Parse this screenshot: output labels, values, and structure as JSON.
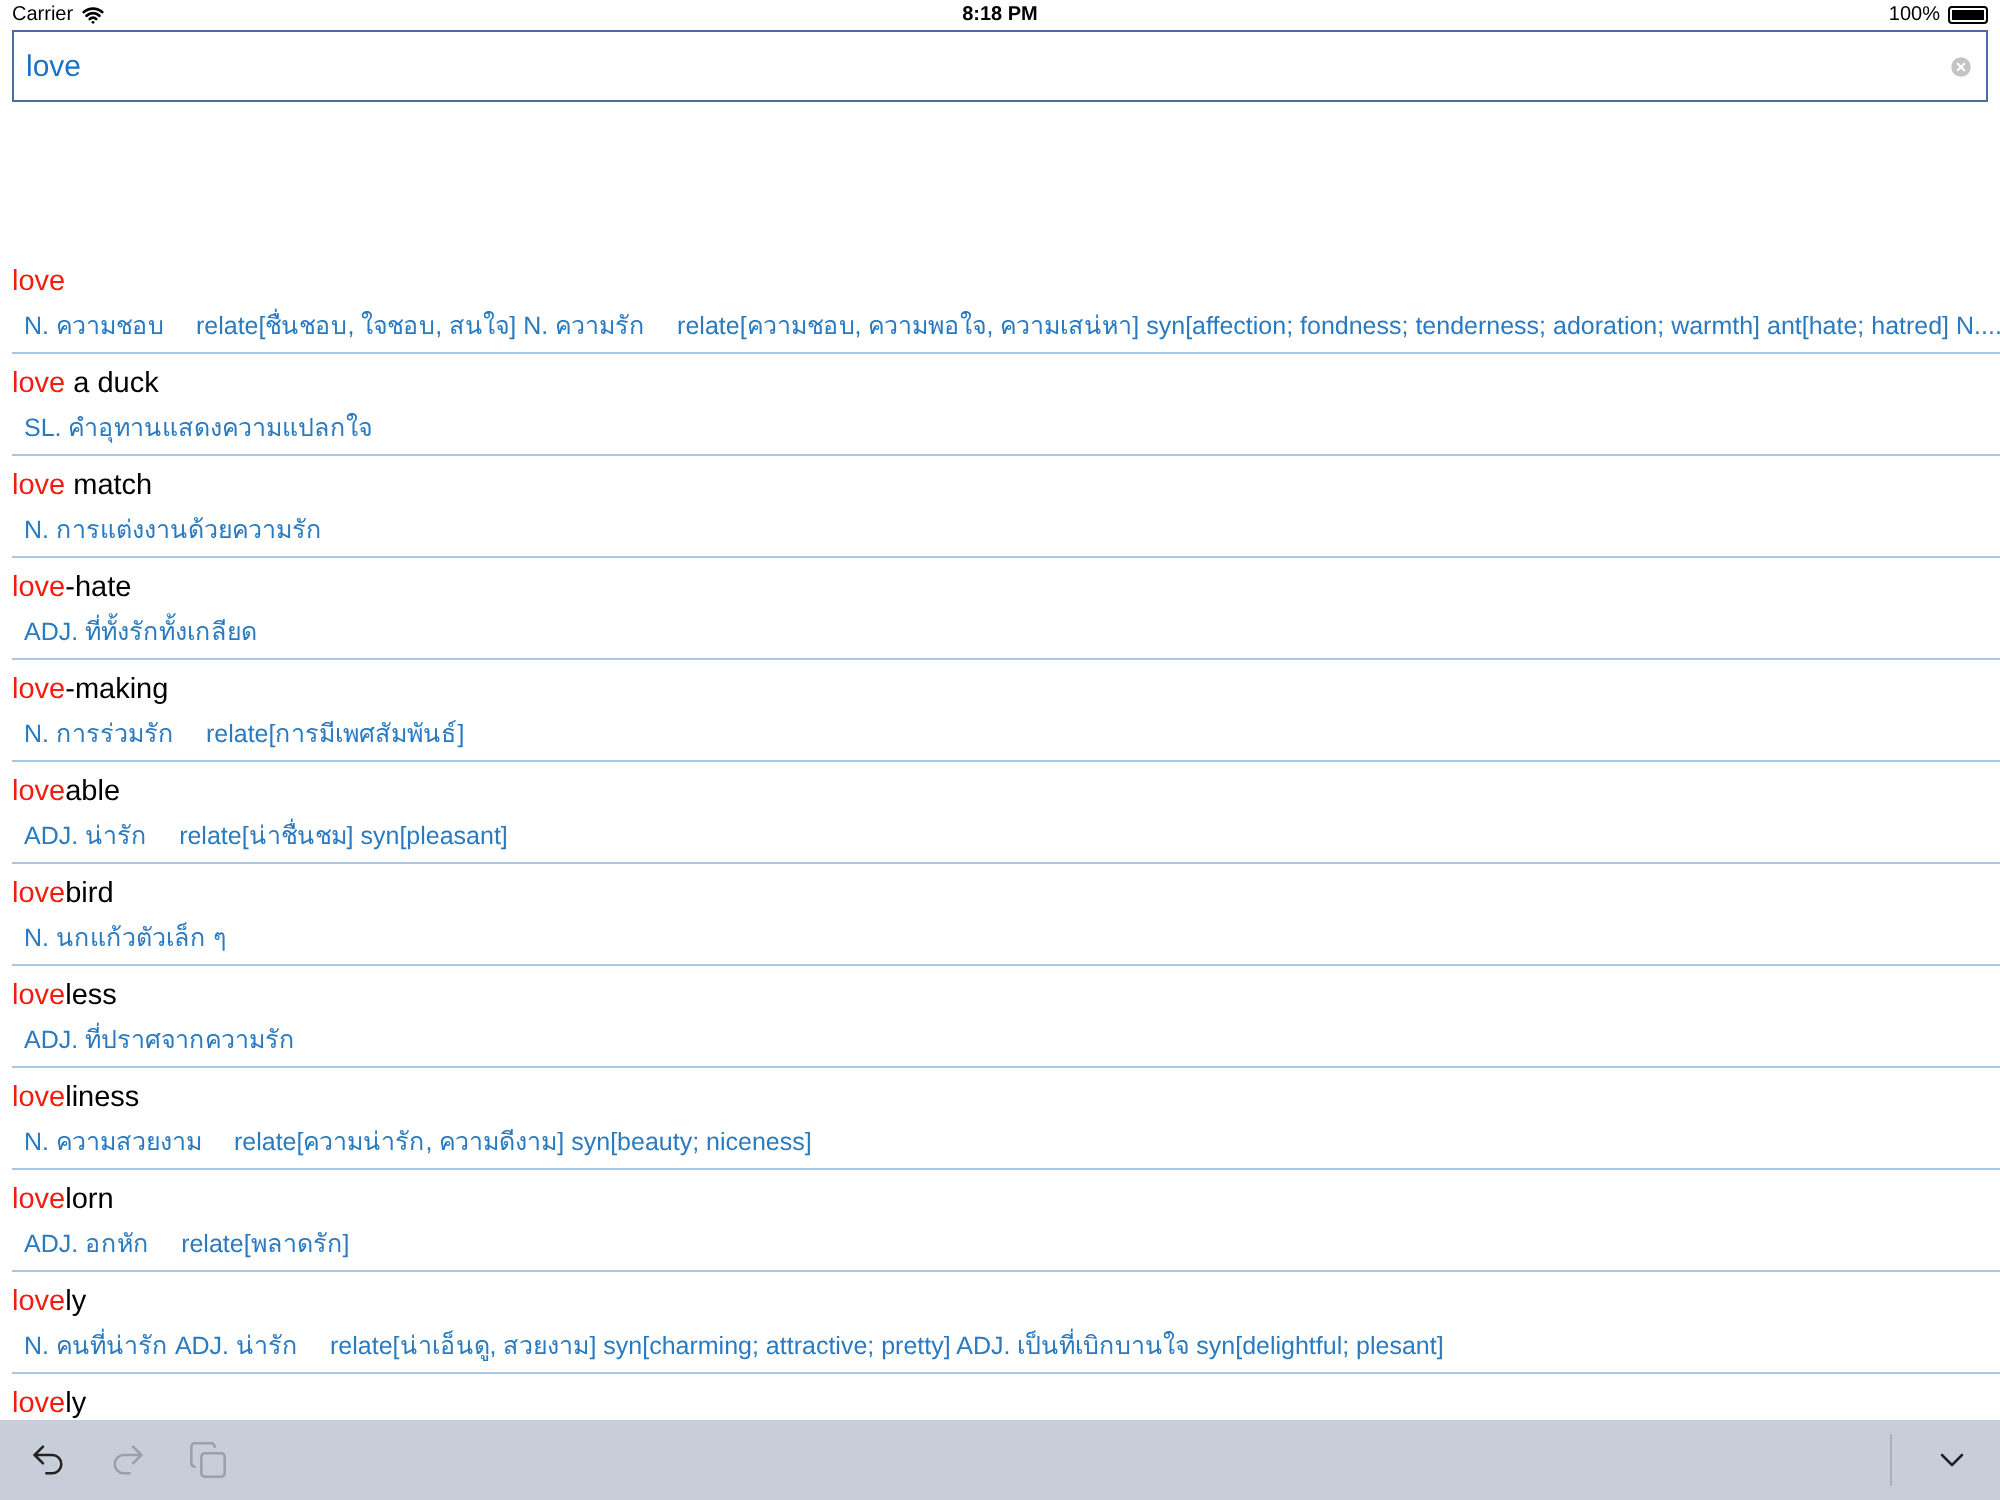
{
  "status_bar": {
    "carrier": "Carrier",
    "time": "8:18 PM",
    "battery": "100%"
  },
  "search": {
    "value": "love"
  },
  "entries": [
    {
      "match": "love",
      "definition": [
        "N. ความชอบ",
        "relate[ชื่นชอบ, ใจชอบ, สนใจ] N. ความรัก",
        "relate[ความชอบ, ความพอใจ, ความเสน่หา] syn[affection; fondness; tenderness; adoration; warmth] ant[hate; hatred] N...."
      ]
    },
    {
      "match": "love",
      "rest": " a duck",
      "definition": [
        "SL. คำอุทานแสดงความแปลกใจ"
      ]
    },
    {
      "match": "love",
      "rest": " match",
      "definition": [
        "N. การแต่งงานด้วยความรัก"
      ]
    },
    {
      "match": "love",
      "rest": "-hate",
      "definition": [
        "ADJ. ที่ทั้งรักทั้งเกลียด"
      ]
    },
    {
      "match": "love",
      "rest": "-making",
      "definition": [
        "N. การร่วมรัก",
        "relate[การมีเพศสัมพันธ์]"
      ]
    },
    {
      "match": "love",
      "rest": "able",
      "definition": [
        "ADJ. น่ารัก",
        "relate[น่าชื่นชม] syn[pleasant]"
      ]
    },
    {
      "match": "love",
      "rest": "bird",
      "definition": [
        "N. นกแก้วตัวเล็ก ๆ"
      ]
    },
    {
      "match": "love",
      "rest": "less",
      "definition": [
        "ADJ. ที่ปราศจากความรัก"
      ]
    },
    {
      "match": "love",
      "rest": "liness",
      "definition": [
        "N. ความสวยงาม",
        "relate[ความน่ารัก, ความดีงาม] syn[beauty; niceness]"
      ]
    },
    {
      "match": "love",
      "rest": "lorn",
      "definition": [
        "ADJ. อกหัก",
        "relate[พลาดรัก]"
      ]
    },
    {
      "match": "love",
      "rest": "ly",
      "definition": [
        "N. คนที่น่ารัก ADJ. น่ารัก",
        "relate[น่าเอ็นดู, สวยงาม] syn[charming; attractive; pretty] ADJ. เป็นที่เบิกบานใจ syn[delightful; plesant]"
      ]
    },
    {
      "match": "love",
      "rest": "ly"
    }
  ],
  "toolbar": [
    {
      "kind": "undo",
      "disabled": false
    },
    {
      "kind": "redo",
      "disabled": true
    },
    {
      "kind": "copy",
      "disabled": true
    },
    {
      "kind": "collapse",
      "disabled": false
    }
  ]
}
